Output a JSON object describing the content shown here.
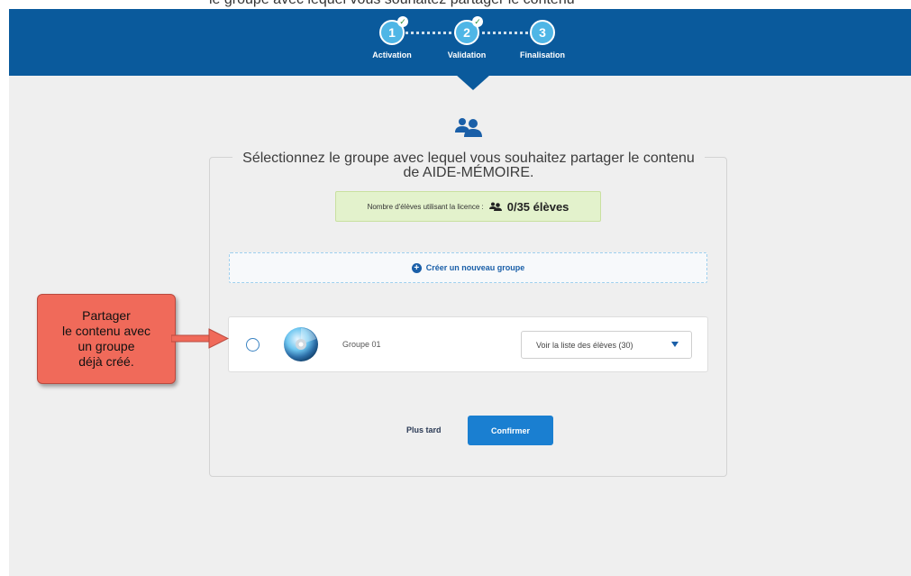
{
  "top_crop_text": "le groupe avec lequel vous souhaitez partager le contenu",
  "steps": [
    {
      "number": "1",
      "label": "Activation",
      "completed": true
    },
    {
      "number": "2",
      "label": "Validation",
      "completed": true
    },
    {
      "number": "3",
      "label": "Finalisation",
      "completed": false
    }
  ],
  "main": {
    "icon": "users-icon",
    "title": "Sélectionnez le groupe avec lequel vous souhaitez partager le contenu de AIDE-MÉMOIRE.",
    "licence_label": "Nombre d'élèves utilisant la licence :",
    "licence_value": "0/35 élèves",
    "create_group_label": "Créer un nouveau groupe",
    "groups": [
      {
        "name": "Groupe 01",
        "select_label": "Voir la liste des élèves (30)",
        "selected": false
      }
    ],
    "later_label": "Plus tard",
    "confirm_label": "Confirmer"
  },
  "annotation": {
    "text": "Partager\nle contenu avec\nun groupe\ndéjà créé."
  },
  "colors": {
    "header": "#0a5a9c",
    "accent": "#1a7fd1",
    "licence_bg": "#e3f2cc",
    "callout": "#f06a5a"
  }
}
